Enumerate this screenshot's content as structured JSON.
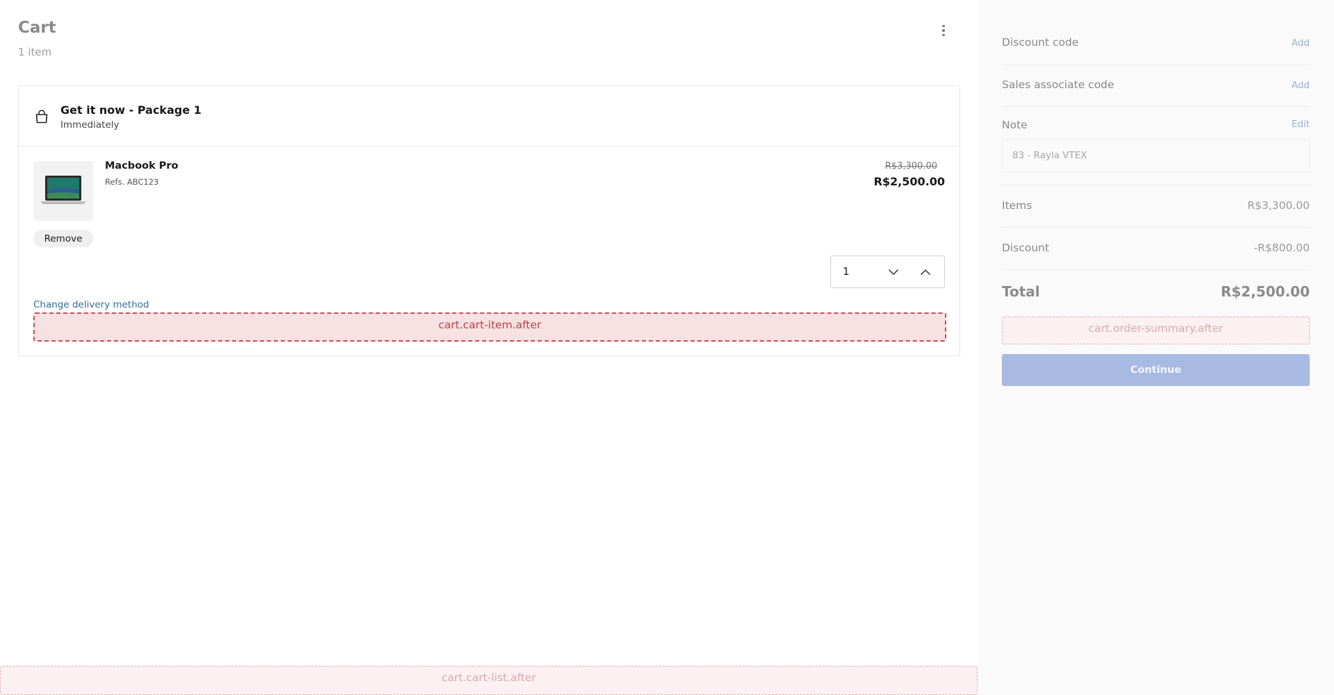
{
  "cart": {
    "title": "Cart",
    "item_count": "1 item"
  },
  "package": {
    "title": "Get it now - Package 1",
    "subtitle": "Immediately",
    "icon": "shopping-bag-icon"
  },
  "item": {
    "name": "Macbook Pro",
    "ref": "Refs. ABC123",
    "price_original": "R$3,300.00",
    "price_current": "R$2,500.00",
    "remove_label": "Remove",
    "quantity": "1",
    "change_delivery_label": "Change delivery method"
  },
  "slots": {
    "cart_item_after": "cart.cart-item.after",
    "cart_list_after": "cart.cart-list.after",
    "order_summary_after": "cart.order-summary.after"
  },
  "summary": {
    "discount_code_label": "Discount code",
    "discount_code_action": "Add",
    "sales_associate_label": "Sales associate code",
    "sales_associate_action": "Add",
    "note_label": "Note",
    "note_action": "Edit",
    "note_value": "83 - Rayla VTEX",
    "items_label": "Items",
    "items_value": "R$3,300.00",
    "discount_label": "Discount",
    "discount_value": "-R$800.00",
    "total_label": "Total",
    "total_value": "R$2,500.00",
    "continue_label": "Continue"
  },
  "colors": {
    "accent_disabled": "#a8b9e2",
    "link": "#2f6f99",
    "slot_border": "#c84b55"
  }
}
